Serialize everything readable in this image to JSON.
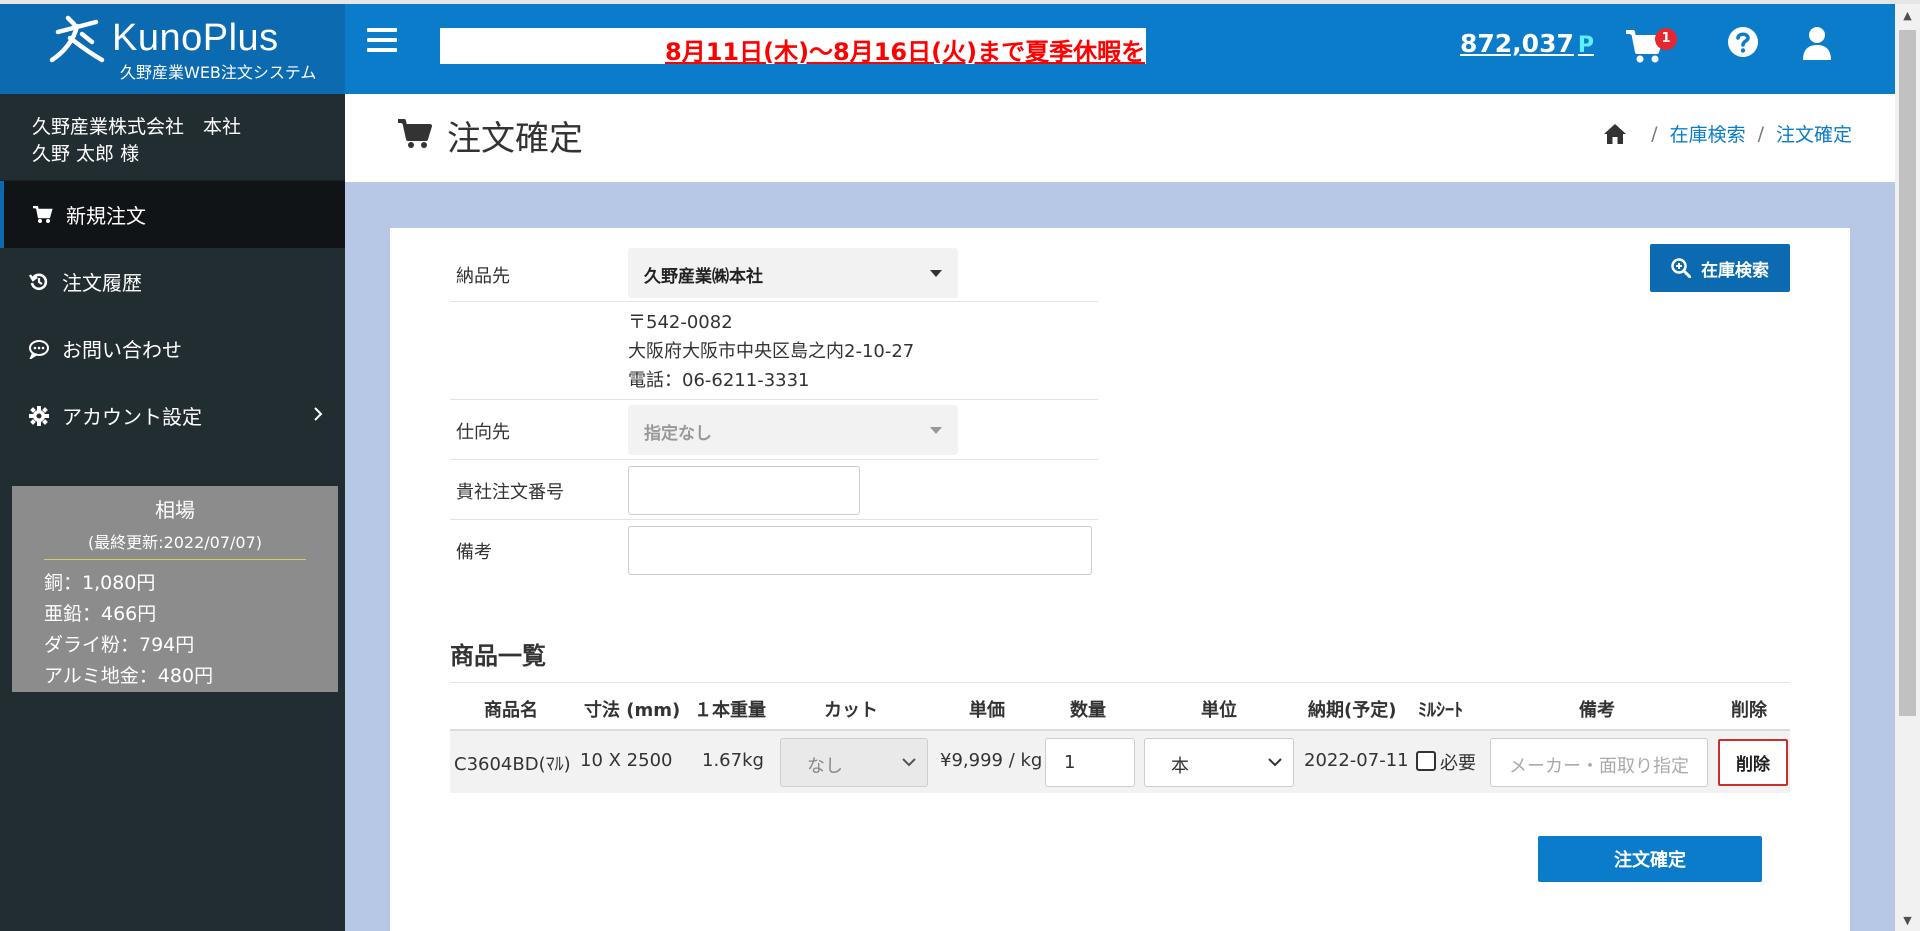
{
  "brand": {
    "title": "KunoPlus",
    "subtitle": "久野産業WEB注文システム"
  },
  "user": {
    "company": "久野産業株式会社　本社",
    "name": "久野  太郎 様"
  },
  "sidebar": {
    "items": [
      {
        "label": "新規注文",
        "icon": "cart-icon",
        "active": true
      },
      {
        "label": "注文履歴",
        "icon": "history-icon"
      },
      {
        "label": "お問い合わせ",
        "icon": "chat-icon"
      },
      {
        "label": "アカウント設定",
        "icon": "gear-icon"
      }
    ]
  },
  "market": {
    "title": "相場",
    "updated": "(最終更新:2022/07/07)",
    "rows": [
      "銅：1,080円",
      "亜鉛：466円",
      "ダライ粉：794円",
      "アルミ地金：480円"
    ]
  },
  "header": {
    "ticker": "8月11日(木)～8月16日(火)まで夏季休暇を",
    "points": "872,037",
    "points_unit": "P",
    "cart_count": "1"
  },
  "page": {
    "title": "注文確定",
    "breadcrumb": [
      "在庫検索",
      "注文確定"
    ]
  },
  "form": {
    "delivery_label": "納品先",
    "delivery_value": "久野産業㈱本社",
    "postal": "〒542-0082",
    "address": "大阪府大阪市中央区島之内2-10-27",
    "phone": "電話：06-6211-3331",
    "destination_label": "仕向先",
    "destination_value": "指定なし",
    "order_no_label": "貴社注文番号",
    "order_no_value": "",
    "remarks_label": "備考",
    "remarks_value": ""
  },
  "stock_search_label": "在庫検索",
  "products": {
    "title": "商品一覧",
    "headers": [
      "商品名",
      "寸法 (mm)",
      "１本重量",
      "カット",
      "単価",
      "数量",
      "単位",
      "納期(予定)",
      "ﾐﾙｼｰﾄ",
      "備考",
      "削除"
    ],
    "rows": [
      {
        "name": "C3604BD(ﾏﾙ)",
        "size": "10 X 2500",
        "weight": "1.67kg",
        "cut": "なし",
        "price": "¥9,999 / kg",
        "qty": "1",
        "unit": "本",
        "delivery": "2022-07-11",
        "mill_sheet_label": "必要",
        "remark_placeholder": "メーカー・面取り指定",
        "delete_label": "削除"
      }
    ]
  },
  "confirm_label": "注文確定",
  "colors": {
    "header_blue": "#0b7cc9",
    "brand_blue": "#0b6ab0",
    "sidebar_bg": "#222d32",
    "ticker_red": "#ff0000"
  }
}
